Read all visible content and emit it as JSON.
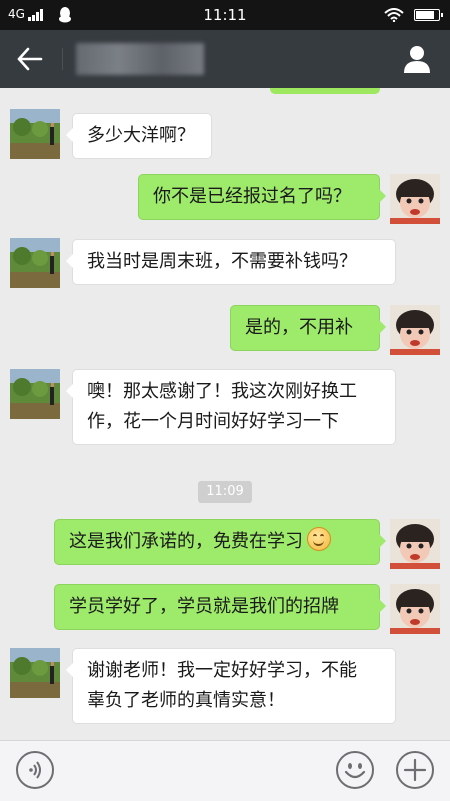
{
  "status_bar": {
    "network": "4G",
    "time": "11:11",
    "battery_level": 0.9
  },
  "header": {
    "title_obscured": true,
    "back_icon": "arrow-left-icon",
    "profile_icon": "person-icon"
  },
  "messages": [
    {
      "side": "left",
      "avatar": "landscape-photo-avatar",
      "lines": [
        "多少大洋啊？"
      ]
    },
    {
      "side": "right",
      "avatar": "child-photo-avatar",
      "lines": [
        "你不是已经报过名了吗？"
      ]
    },
    {
      "side": "left",
      "avatar": "landscape-photo-avatar",
      "lines": [
        "我当时是周末班，不需要补钱吗？"
      ]
    },
    {
      "side": "right",
      "avatar": "child-photo-avatar",
      "lines": [
        "是的，不用补"
      ]
    },
    {
      "side": "left",
      "avatar": "landscape-photo-avatar",
      "lines": [
        "噢！那太感谢了！我这次刚好换工",
        "作，花一个月时间好好学习一下"
      ]
    },
    {
      "side": "right",
      "avatar": "child-photo-avatar",
      "lines": [
        "这是我们承诺的，免费在学习"
      ],
      "emoji": "smile-emoji-icon"
    },
    {
      "side": "right",
      "avatar": "child-photo-avatar",
      "lines": [
        "学员学好了，学员就是我们的招牌"
      ]
    },
    {
      "side": "left",
      "avatar": "landscape-photo-avatar",
      "lines": [
        "谢谢老师！我一定好好学习，不能",
        "辜负了老师的真情实意！"
      ]
    }
  ],
  "timestamp": "11:09",
  "input_bar": {
    "voice_icon": "voice-icon",
    "emoji_icon": "emoji-icon",
    "plus_icon": "plus-icon"
  },
  "colors": {
    "nav_bg": "#363b40",
    "status_bg": "#141414",
    "chat_bg": "#ebebeb",
    "bubble_right": "#9eea6a",
    "bubble_left": "#ffffff"
  }
}
